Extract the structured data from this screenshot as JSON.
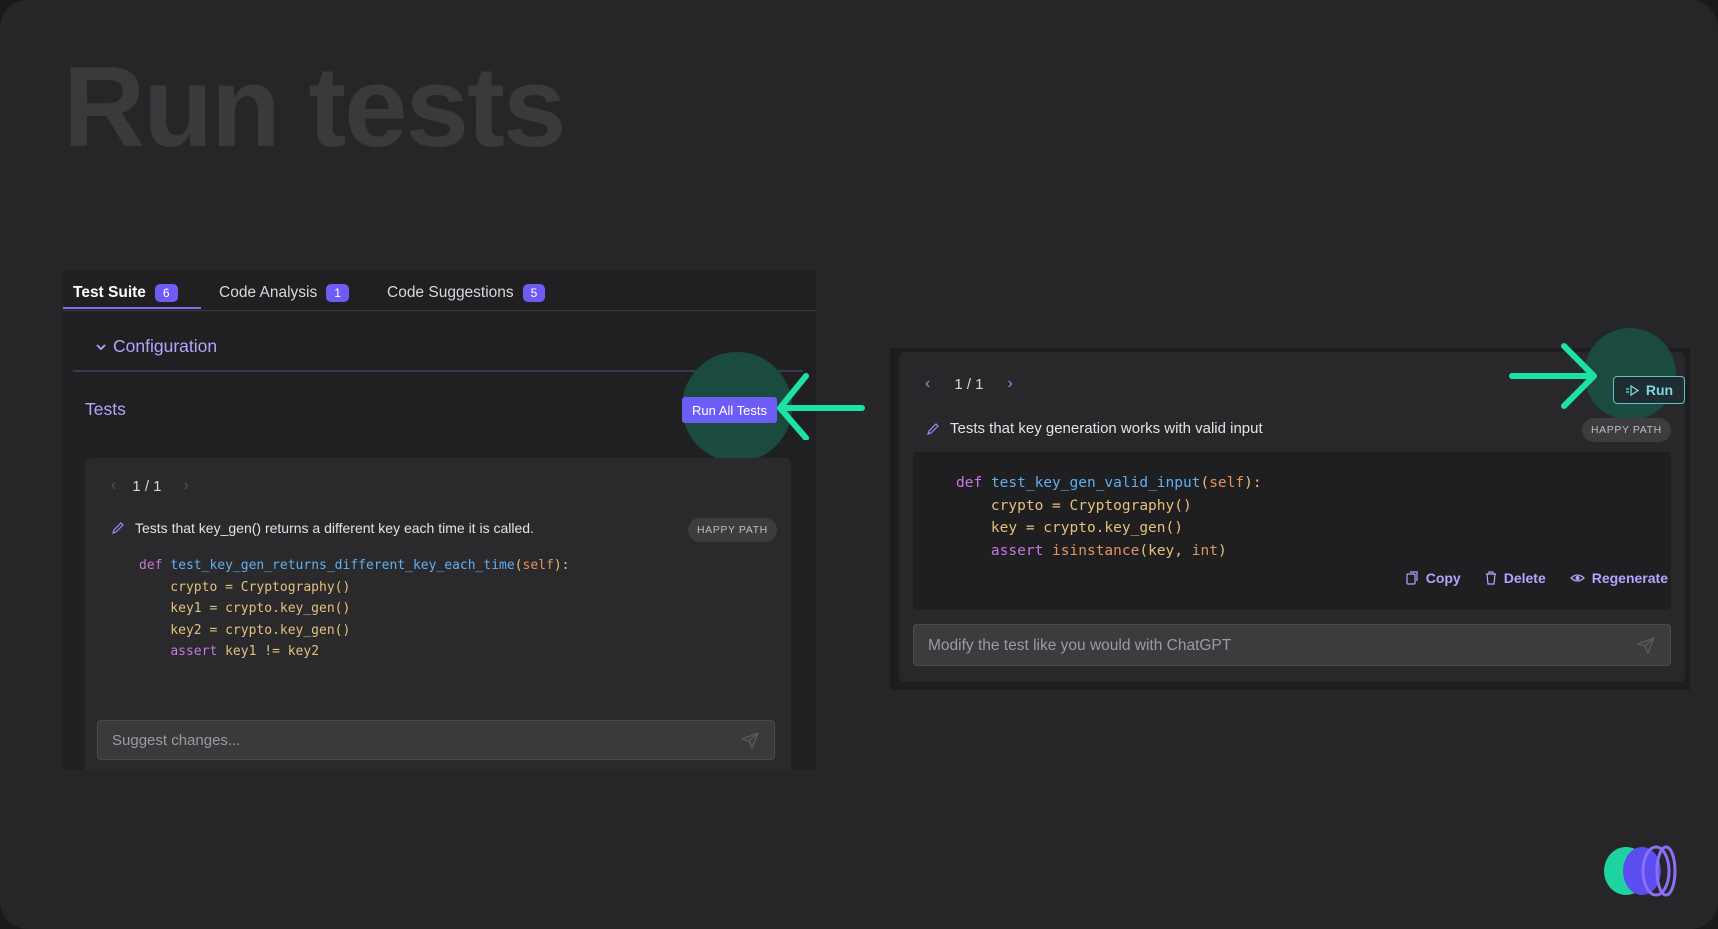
{
  "slide_title": "Run tests",
  "colors": {
    "accent": "#6d5df5",
    "accent_text": "#b1a6ff",
    "highlight_arrow": "#1de2a7",
    "glow": "#1a4b3e",
    "run_button": "#52c7ce"
  },
  "left_panel": {
    "tabs": [
      {
        "label": "Test Suite",
        "count": "6"
      },
      {
        "label": "Code Analysis",
        "count": "1"
      },
      {
        "label": "Code Suggestions",
        "count": "5"
      }
    ],
    "configuration_label": "Configuration",
    "tests_label": "Tests",
    "run_all_label": "Run All Tests",
    "pager": "1 / 1",
    "description": "Tests that key_gen() returns a different key each time it is called.",
    "tag": "HAPPY PATH",
    "code": [
      "def test_key_gen_returns_different_key_each_time(self):",
      "    crypto = Cryptography()",
      "    key1 = crypto.key_gen()",
      "    key2 = crypto.key_gen()",
      "    assert key1 != key2"
    ],
    "input_placeholder": "Suggest changes..."
  },
  "right_panel": {
    "pager": "1 / 1",
    "run_label": "Run",
    "description": "Tests that key generation works with valid input",
    "tag": "HAPPY PATH",
    "code": [
      "def test_key_gen_valid_input(self):",
      "    crypto = Cryptography()",
      "    key = crypto.key_gen()",
      "    assert isinstance(key, int)"
    ],
    "actions": [
      "Copy",
      "Delete",
      "Regenerate"
    ],
    "input_placeholder": "Modify the test like you would with ChatGPT"
  },
  "icons": [
    "chevron-down-icon",
    "chevron-left-icon",
    "chevron-right-icon",
    "pencil-icon",
    "send-icon",
    "run-icon",
    "copy-icon",
    "trash-icon",
    "regenerate-icon",
    "arrow-icon",
    "logo-icon"
  ]
}
